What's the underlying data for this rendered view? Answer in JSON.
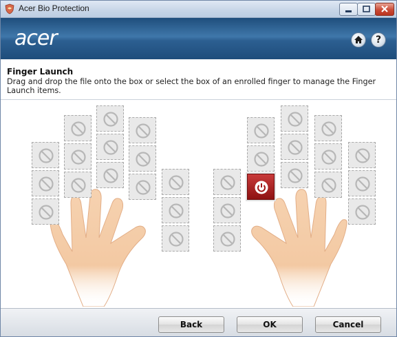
{
  "window": {
    "title": "Acer Bio Protection",
    "icon": "shield-app-icon"
  },
  "header": {
    "logo": "acer",
    "home_icon": "home-icon",
    "help_label": "?"
  },
  "section": {
    "title": "Finger Launch",
    "description": "Drag and drop the file onto the box or select the box of an enrolled finger to manage the Finger Launch items."
  },
  "finger_slots": {
    "empty_icon": "no-entry-icon",
    "active_icon": "power-icon",
    "left_hand": {
      "little": 3,
      "ring": 3,
      "middle": 3,
      "index": 3,
      "thumb": 3
    },
    "right_hand": {
      "thumb": 3,
      "index": 3,
      "middle": 3,
      "ring": 3,
      "little": 3
    },
    "active_slot": "right-index-bottom"
  },
  "footer": {
    "back_label": "Back",
    "ok_label": "OK",
    "cancel_label": "Cancel"
  },
  "colors": {
    "header": "#2c5f91",
    "active_slot": "#b02222",
    "skin": "#f3c9a3"
  }
}
